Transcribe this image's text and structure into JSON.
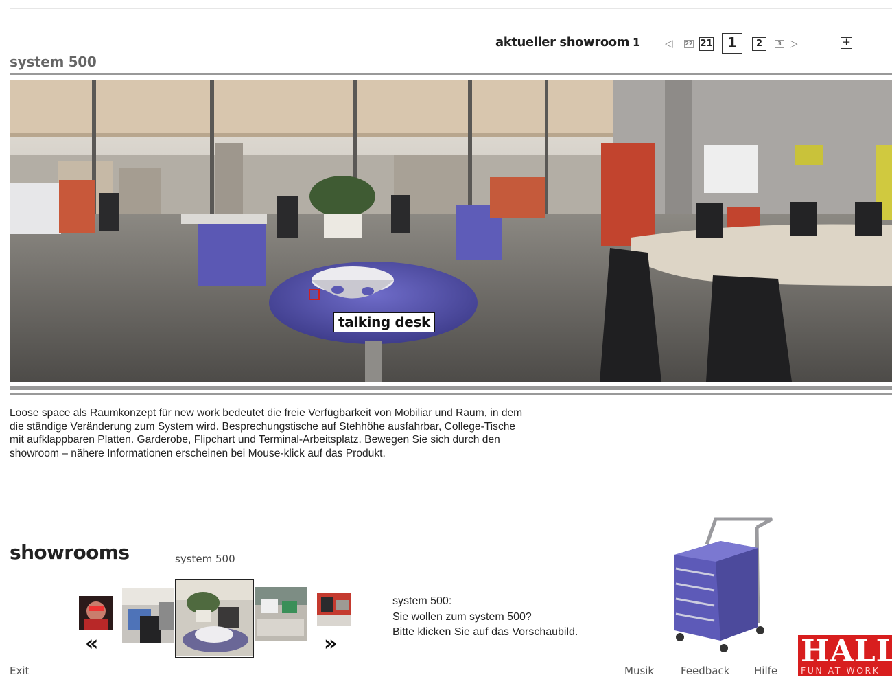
{
  "header": {
    "section_title": "system 500",
    "current_showroom_label": "aktueller showroom",
    "current_showroom_number": "1",
    "pager": {
      "prev_icon": "triangle-left-icon",
      "first_mini": "22",
      "page_21": "21",
      "page_1": "1",
      "page_2": "2",
      "last_mini": "3",
      "next_icon": "triangle-right-icon"
    },
    "expand_icon": "plus-box-icon",
    "expand_symbol": "+"
  },
  "panorama": {
    "hotspot_label": "talking desk"
  },
  "description": "Loose space als Raumkonzept für new work bedeutet die freie Verfügbarkeit von Mobiliar und Raum, in dem die ständige Veränderung zum System wird. Besprechungstische auf Stehhöhe ausfahrbar, College-Tische mit aufklappbaren Platten. Garderobe, Flipchart und Terminal-Arbeitsplatz. Bewegen Sie sich durch den showroom – nähere Informationen erscheinen bei Mouse-klick auf das Produkt.",
  "showrooms": {
    "title": "showrooms",
    "selected_caption": "system 500",
    "prev_label": "«",
    "next_label": "»",
    "info_lines": [
      "system 500:",
      "Sie wollen zum system 500?",
      "Bitte klicken Sie auf das Vorschaubild."
    ]
  },
  "footer": {
    "exit": "Exit",
    "musik": "Musik",
    "feedback": "Feedback",
    "hilfe": "Hilfe"
  },
  "logo": {
    "word": "HALL",
    "tagline": "FUN AT WORK"
  },
  "colors": {
    "accent_red": "#d81e1e",
    "furniture_blue": "#5e5cb8",
    "rule_gray": "#999999"
  }
}
